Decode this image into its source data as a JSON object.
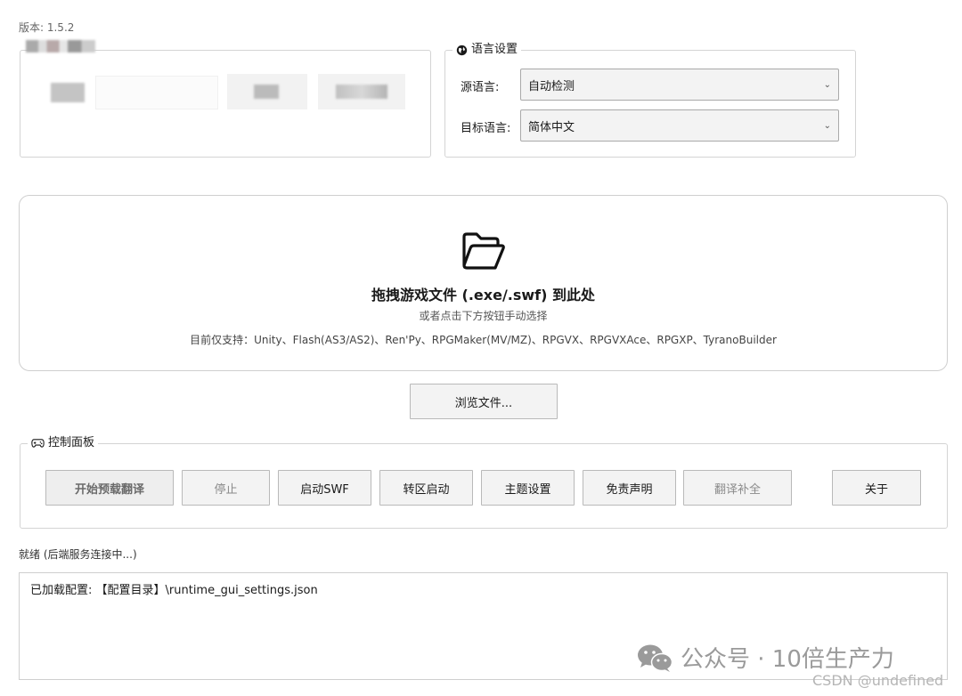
{
  "version_label": "版本: 1.5.2",
  "language_settings": {
    "title": "语言设置",
    "source_label": "源语言:",
    "source_value": "自动检测",
    "target_label": "目标语言:",
    "target_value": "简体中文"
  },
  "drop_zone": {
    "title": "拖拽游戏文件 (.exe/.swf) 到此处",
    "subtitle": "或者点击下方按钮手动选择",
    "supported": "目前仅支持：Unity、Flash(AS3/AS2)、Ren'Py、RPGMaker(MV/MZ)、RPGVX、RPGVXAce、RPGXP、TyranoBuilder"
  },
  "browse_button": "浏览文件...",
  "control_panel": {
    "title": "控制面板",
    "buttons": [
      {
        "label": "开始预载翻译"
      },
      {
        "label": "停止"
      },
      {
        "label": "启动SWF"
      },
      {
        "label": "转区启动"
      },
      {
        "label": "主题设置"
      },
      {
        "label": "免责声明"
      },
      {
        "label": "翻译补全"
      },
      {
        "label": "关于"
      }
    ]
  },
  "status_text": "就绪 (后端服务连接中...)",
  "log_text": "已加载配置: 【配置目录】\\runtime_gui_settings.json",
  "watermark": {
    "text": "公众号 · 10倍生产力",
    "csdn": "CSDN @undefined"
  },
  "icons": {
    "language": "globe-icon",
    "folder": "folder-open-icon",
    "control": "gamepad-icon",
    "watermark": "wechat-icon"
  }
}
